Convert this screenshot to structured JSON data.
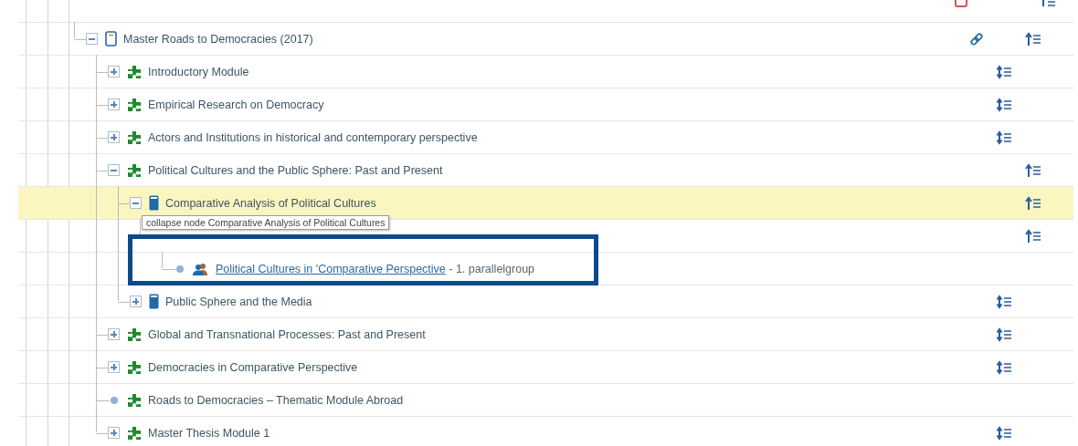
{
  "tree": [
    {
      "label": "Master Roads to Democracies (2017)",
      "kind": "program",
      "expanded": true,
      "sort_up": true,
      "sort_both": false,
      "link": true,
      "children": [
        {
          "label": "Introductory Module",
          "kind": "module",
          "expanded": false,
          "sort_up": false,
          "sort_both": true
        },
        {
          "label": "Empirical Research on Democracy",
          "kind": "module",
          "expanded": false,
          "sort_up": false,
          "sort_both": true
        },
        {
          "label": "Actors and Institutions in historical and contemporary perspective",
          "kind": "module",
          "expanded": false,
          "sort_up": false,
          "sort_both": true
        },
        {
          "label": "Political Cultures and the Public Sphere: Past and Present",
          "kind": "module",
          "expanded": true,
          "sort_up": true,
          "sort_both": false,
          "children": [
            {
              "label": "Comparative Analysis of Political Cultures",
              "kind": "course",
              "expanded": true,
              "selected": true,
              "sort_up": true,
              "sort_both": false,
              "tooltip": "collapse node Comparative Analysis of Political Cultures",
              "children": [
                {
                  "kind": "seminar",
                  "sort_up": true,
                  "sort_both": false,
                  "children": [
                    {
                      "kind": "group",
                      "link_text": "Political Cultures in 'Comparative Perspective",
                      "label": " - 1. parallelgroup"
                    }
                  ]
                }
              ]
            },
            {
              "label": "Public Sphere and the Media",
              "kind": "course",
              "expanded": false,
              "sort_up": false,
              "sort_both": true
            }
          ]
        },
        {
          "label": "Global and Transnational Processes: Past and Present",
          "kind": "module",
          "expanded": false,
          "sort_up": false,
          "sort_both": true
        },
        {
          "label": "Democracies in Comparative Perspective",
          "kind": "module",
          "expanded": false,
          "sort_up": false,
          "sort_both": true
        },
        {
          "label": "Roads to Democracies – Thematic Module Abroad",
          "kind": "module",
          "sort_up": false,
          "sort_both": false
        },
        {
          "label": "Master Thesis Module 1",
          "kind": "module",
          "expanded": false,
          "sort_up": false,
          "sort_both": true
        }
      ]
    }
  ]
}
